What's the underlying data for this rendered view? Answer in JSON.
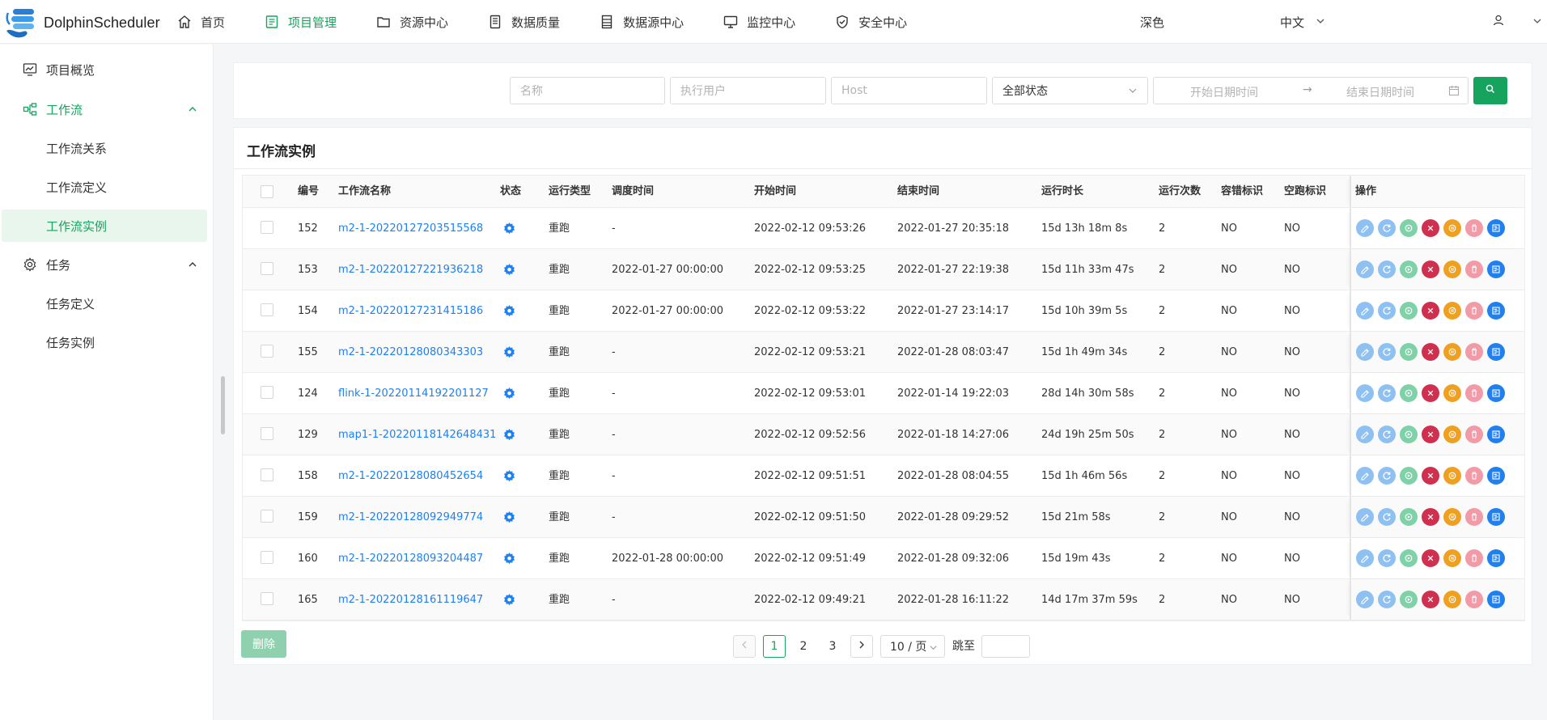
{
  "header": {
    "brand": "DolphinScheduler",
    "nav": [
      {
        "label": "首页",
        "icon": "home-icon"
      },
      {
        "label": "项目管理",
        "icon": "project-icon"
      },
      {
        "label": "资源中心",
        "icon": "folder-icon"
      },
      {
        "label": "数据质量",
        "icon": "data-quality-icon"
      },
      {
        "label": "数据源中心",
        "icon": "datasource-icon"
      },
      {
        "label": "监控中心",
        "icon": "monitor-icon"
      },
      {
        "label": "安全中心",
        "icon": "shield-icon"
      }
    ],
    "active_nav": "项目管理",
    "theme": "深色",
    "language": "中文",
    "accent": "#16a35d"
  },
  "sidebar": {
    "overview": "项目概览",
    "workflow_group": "工作流",
    "workflow_items": [
      "工作流关系",
      "工作流定义",
      "工作流实例"
    ],
    "active_item": "工作流实例",
    "task_group": "任务",
    "task_items": [
      "任务定义",
      "任务实例"
    ]
  },
  "filters": {
    "name_placeholder": "名称",
    "user_placeholder": "执行用户",
    "host_placeholder": "Host",
    "state_value": "全部状态",
    "start_placeholder": "开始日期时间",
    "end_placeholder": "结束日期时间",
    "range_separator": "→"
  },
  "table": {
    "title": "工作流实例",
    "columns": [
      "编号",
      "工作流名称",
      "状态",
      "运行类型",
      "调度时间",
      "开始时间",
      "结束时间",
      "运行时长",
      "运行次数",
      "容错标识",
      "空跑标识",
      "操作"
    ],
    "rows": [
      {
        "id": "152",
        "name": "m2-1-20220127203515568",
        "type": "重跑",
        "schedule": "-",
        "start": "2022-02-12 09:53:26",
        "end": "2022-01-27 20:35:18",
        "duration": "15d 13h 18m 8s",
        "runs": "2",
        "failover": "NO",
        "dryrun": "NO"
      },
      {
        "id": "153",
        "name": "m2-1-20220127221936218",
        "type": "重跑",
        "schedule": "2022-01-27 00:00:00",
        "start": "2022-02-12 09:53:25",
        "end": "2022-01-27 22:19:38",
        "duration": "15d 11h 33m 47s",
        "runs": "2",
        "failover": "NO",
        "dryrun": "NO"
      },
      {
        "id": "154",
        "name": "m2-1-20220127231415186",
        "type": "重跑",
        "schedule": "2022-01-27 00:00:00",
        "start": "2022-02-12 09:53:22",
        "end": "2022-01-27 23:14:17",
        "duration": "15d 10h 39m 5s",
        "runs": "2",
        "failover": "NO",
        "dryrun": "NO"
      },
      {
        "id": "155",
        "name": "m2-1-20220128080343303",
        "type": "重跑",
        "schedule": "-",
        "start": "2022-02-12 09:53:21",
        "end": "2022-01-28 08:03:47",
        "duration": "15d 1h 49m 34s",
        "runs": "2",
        "failover": "NO",
        "dryrun": "NO"
      },
      {
        "id": "124",
        "name": "flink-1-20220114192201127",
        "type": "重跑",
        "schedule": "-",
        "start": "2022-02-12 09:53:01",
        "end": "2022-01-14 19:22:03",
        "duration": "28d 14h 30m 58s",
        "runs": "2",
        "failover": "NO",
        "dryrun": "NO"
      },
      {
        "id": "129",
        "name": "map1-1-20220118142648431",
        "type": "重跑",
        "schedule": "-",
        "start": "2022-02-12 09:52:56",
        "end": "2022-01-18 14:27:06",
        "duration": "24d 19h 25m 50s",
        "runs": "2",
        "failover": "NO",
        "dryrun": "NO"
      },
      {
        "id": "158",
        "name": "m2-1-20220128080452654",
        "type": "重跑",
        "schedule": "-",
        "start": "2022-02-12 09:51:51",
        "end": "2022-01-28 08:04:55",
        "duration": "15d 1h 46m 56s",
        "runs": "2",
        "failover": "NO",
        "dryrun": "NO"
      },
      {
        "id": "159",
        "name": "m2-1-20220128092949774",
        "type": "重跑",
        "schedule": "-",
        "start": "2022-02-12 09:51:50",
        "end": "2022-01-28 09:29:52",
        "duration": "15d 21m 58s",
        "runs": "2",
        "failover": "NO",
        "dryrun": "NO"
      },
      {
        "id": "160",
        "name": "m2-1-20220128093204487",
        "type": "重跑",
        "schedule": "2022-01-28 00:00:00",
        "start": "2022-02-12 09:51:49",
        "end": "2022-01-28 09:32:06",
        "duration": "15d 19m 43s",
        "runs": "2",
        "failover": "NO",
        "dryrun": "NO"
      },
      {
        "id": "165",
        "name": "m2-1-20220128161119647",
        "type": "重跑",
        "schedule": "-",
        "start": "2022-02-12 09:49:21",
        "end": "2022-01-28 16:11:22",
        "duration": "14d 17m 37m 59s",
        "runs": "2",
        "failover": "NO",
        "dryrun": "NO"
      }
    ],
    "operations": [
      {
        "icon": "edit-icon",
        "color": "#8ec1f2"
      },
      {
        "icon": "rerun-icon",
        "color": "#8ec1f2"
      },
      {
        "icon": "recover-icon",
        "color": "#7fd1a8"
      },
      {
        "icon": "stop-icon",
        "color": "#d03050"
      },
      {
        "icon": "pause-icon",
        "color": "#f0a020"
      },
      {
        "icon": "delete-icon",
        "color": "#f29aa6"
      },
      {
        "icon": "gantt-icon",
        "color": "#2080f0"
      }
    ]
  },
  "footer": {
    "delete_label": "删除",
    "pages": [
      "1",
      "2",
      "3"
    ],
    "current_page": "1",
    "page_size": "10 / 页",
    "jump_label": "跳至"
  }
}
